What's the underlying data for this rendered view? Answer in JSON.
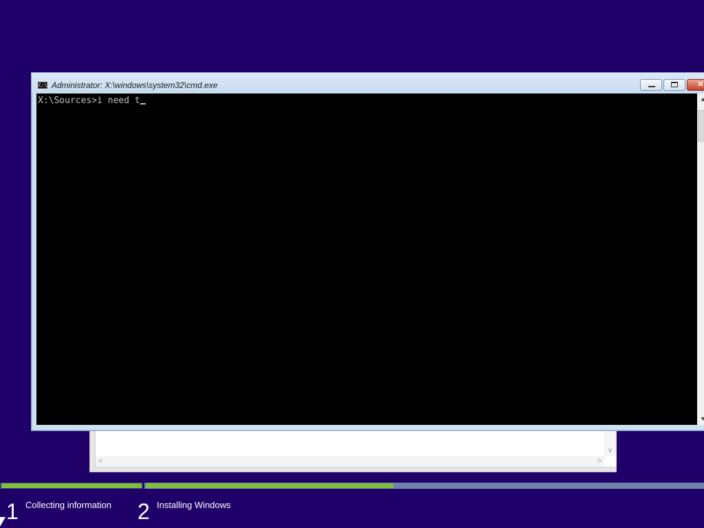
{
  "colors": {
    "background": "#1f0068",
    "console_background": "#000000",
    "console_text": "#c0c0c0",
    "progress_complete": "#7fbf3b"
  },
  "console_window": {
    "title": "Administrator: X:\\windows\\system32\\cmd.exe",
    "icon": "console-app-icon",
    "prompt": "X:\\Sources>",
    "input_text": "i need t",
    "buttons": {
      "minimize": "minimize-icon",
      "maximize": "maximize-icon",
      "close": "close-icon"
    }
  },
  "setup_progress": {
    "step1": {
      "number": "1",
      "label": "Collecting information",
      "progress": 1.0
    },
    "step2": {
      "number": "2",
      "label": "Installing Windows",
      "progress": 0.445
    }
  }
}
